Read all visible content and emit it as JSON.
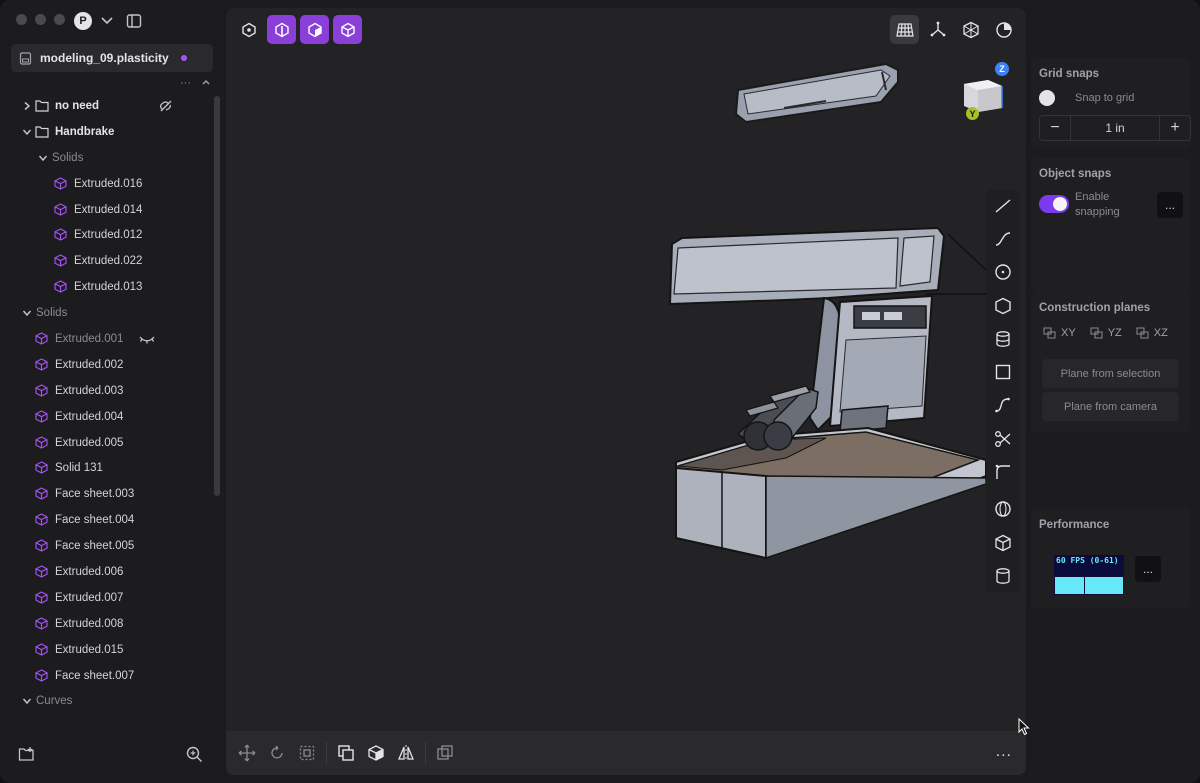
{
  "window": {
    "file_name": "modeling_09.plasticity",
    "avatar_initial": "P"
  },
  "outliner": {
    "items": [
      {
        "label": "no need",
        "kind": "folder",
        "level": 0,
        "expanded": false,
        "style": "bold",
        "badge": "hidden-icon"
      },
      {
        "label": "Handbrake",
        "kind": "folder",
        "level": 0,
        "expanded": true,
        "style": "bold"
      },
      {
        "label": "Solids",
        "kind": "group",
        "level": 1,
        "expanded": true,
        "style": "muted"
      },
      {
        "label": "Extruded.016",
        "kind": "solid",
        "level": 2
      },
      {
        "label": "Extruded.014",
        "kind": "solid",
        "level": 2
      },
      {
        "label": "Extruded.012",
        "kind": "solid",
        "level": 2
      },
      {
        "label": "Extruded.022",
        "kind": "solid",
        "level": 2
      },
      {
        "label": "Extruded.013",
        "kind": "solid",
        "level": 2
      },
      {
        "label": "Solids",
        "kind": "group",
        "level": 0,
        "expanded": true,
        "style": "muted"
      },
      {
        "label": "Extruded.001",
        "kind": "solid",
        "level": 1,
        "style": "dim",
        "badge": "hidden-eye-icon"
      },
      {
        "label": "Extruded.002",
        "kind": "solid",
        "level": 1
      },
      {
        "label": "Extruded.003",
        "kind": "solid",
        "level": 1
      },
      {
        "label": "Extruded.004",
        "kind": "solid",
        "level": 1
      },
      {
        "label": "Extruded.005",
        "kind": "solid",
        "level": 1
      },
      {
        "label": "Solid 131",
        "kind": "solid",
        "level": 1
      },
      {
        "label": "Face sheet.003",
        "kind": "solid",
        "level": 1
      },
      {
        "label": "Face sheet.004",
        "kind": "solid",
        "level": 1
      },
      {
        "label": "Face sheet.005",
        "kind": "solid",
        "level": 1
      },
      {
        "label": "Extruded.006",
        "kind": "solid",
        "level": 1
      },
      {
        "label": "Extruded.007",
        "kind": "solid",
        "level": 1
      },
      {
        "label": "Extruded.008",
        "kind": "solid",
        "level": 1
      },
      {
        "label": "Extruded.015",
        "kind": "solid",
        "level": 1
      },
      {
        "label": "Face sheet.007",
        "kind": "solid",
        "level": 1
      },
      {
        "label": "Curves",
        "kind": "group",
        "level": 0,
        "expanded": true,
        "style": "muted"
      }
    ]
  },
  "viewport": {
    "top_toolbar": [
      "vertex-select-icon",
      "edge-select-icon",
      "face-select-icon",
      "solid-select-icon"
    ],
    "view_tools": [
      "grid-icon",
      "axes-icon",
      "xray-icon",
      "render-mode-icon"
    ],
    "nav_cube": {
      "z_label": "Z",
      "y_label": "Y"
    },
    "side_tools": [
      "line-icon",
      "curve-icon",
      "circle-icon",
      "polygon-icon",
      "cylinder-stack-icon",
      "rectangle-icon",
      "spline-icon",
      "scissors-icon",
      "fillet-curve-icon",
      "sphere-icon",
      "box-icon",
      "cylinder-icon"
    ],
    "bottom_tools": [
      "move-icon",
      "rotate-icon",
      "scale-icon",
      "duplicate-icon",
      "offset-icon",
      "mirror-icon",
      "boolean-icon"
    ],
    "more_label": "..."
  },
  "panel": {
    "grid_snaps": {
      "title": "Grid snaps",
      "snap_label": "Snap to grid",
      "value": "1 in",
      "minus": "−",
      "plus": "+"
    },
    "object_snaps": {
      "title": "Object snaps",
      "enable_label_1": "Enable",
      "enable_label_2": "snapping",
      "more": "..."
    },
    "construction_planes": {
      "title": "Construction planes",
      "planes": [
        "XY",
        "YZ",
        "XZ"
      ],
      "from_selection": "Plane from selection",
      "from_camera": "Plane from camera"
    },
    "performance": {
      "title": "Performance",
      "fps_text": "60 FPS (0-61)",
      "more": "..."
    }
  }
}
